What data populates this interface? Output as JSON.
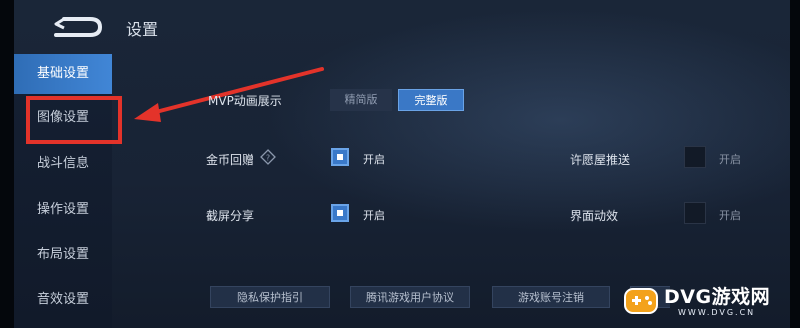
{
  "header": {
    "title": "设置",
    "back_icon": "back-arrow-icon"
  },
  "sidebar": {
    "items": [
      {
        "label": "基础设置",
        "active": true
      },
      {
        "label": "图像设置",
        "active": false
      },
      {
        "label": "战斗信息",
        "active": false
      },
      {
        "label": "操作设置",
        "active": false
      },
      {
        "label": "布局设置",
        "active": false
      },
      {
        "label": "音效设置",
        "active": false
      }
    ]
  },
  "settings": {
    "mvp": {
      "label": "MVP动画展示",
      "options": [
        "精简版",
        "完整版"
      ],
      "selected": "完整版"
    },
    "gold_replay": {
      "label": "金币回赠",
      "state": "开启",
      "checked": true
    },
    "screenshot_share": {
      "label": "截屏分享",
      "state": "开启",
      "checked": true
    },
    "wish_push": {
      "label": "许愿屋推送",
      "state": "开启",
      "checked": false
    },
    "ui_animation": {
      "label": "界面动效",
      "state": "开启",
      "checked": false
    }
  },
  "footer": {
    "buttons": [
      "隐私保护指引",
      "腾讯游戏用户协议",
      "游戏账号注销"
    ]
  },
  "annotation": {
    "color": "#e3332a"
  },
  "watermark": {
    "text": "DVG游戏网",
    "sub": "WWW.DVG.CN"
  },
  "colors": {
    "accent": "#3a78c6",
    "annotation": "#e3332a",
    "background": "#182335"
  }
}
